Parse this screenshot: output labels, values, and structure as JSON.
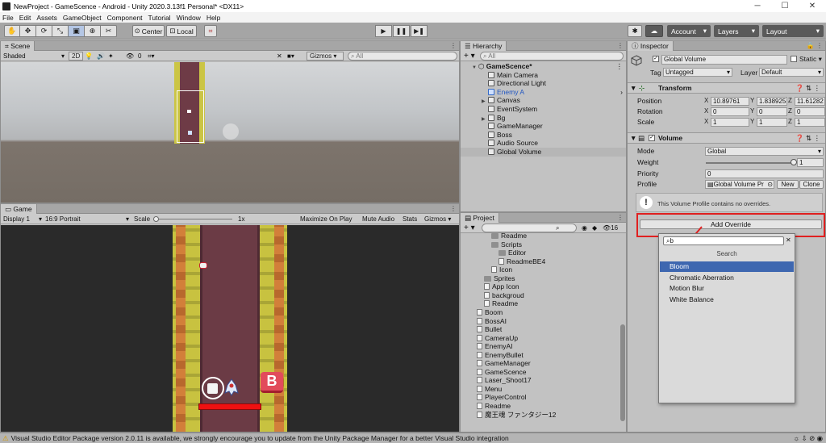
{
  "window": {
    "title": "NewProject - GameScence - Android - Unity 2020.3.13f1 Personal* <DX11>",
    "minimize": "─",
    "maximize": "☐",
    "close": "✕"
  },
  "menu": [
    "File",
    "Edit",
    "Assets",
    "GameObject",
    "Component",
    "Tutorial",
    "Window",
    "Help"
  ],
  "toolbar": {
    "tools": [
      "✋",
      "✥",
      "⟳",
      "⤡",
      "▣",
      "⊕",
      "✂"
    ],
    "pivot": "Center",
    "space": "Local",
    "grid": "⌗",
    "play": "▶",
    "pause": "❚❚",
    "step": "▶❚",
    "collab": "✱",
    "cloud": "☁",
    "account": "Account",
    "layers": "Layers",
    "layout": "Layout"
  },
  "scene": {
    "tab": "Scene",
    "shading": "Shaded",
    "mode2d": "2D",
    "hidden_count": "0",
    "gizmos": "Gizmos",
    "search_placeholder": "All"
  },
  "game": {
    "tab": "Game",
    "display": "Display 1",
    "aspect": "16:9 Portrait",
    "scale_label": "Scale",
    "scale_value": "1x",
    "maximize": "Maximize On Play",
    "mute": "Mute Audio",
    "stats": "Stats",
    "gizmos": "Gizmos",
    "boss_letter": "B"
  },
  "hierarchy": {
    "tab": "Hierarchy",
    "add": "+",
    "search_placeholder": "All",
    "scene_name": "GameScence*",
    "items": [
      {
        "label": "Main Camera",
        "icon": "cube",
        "expandable": false,
        "selected": false,
        "blue": false
      },
      {
        "label": "Directional Light",
        "icon": "cube",
        "expandable": false,
        "selected": false,
        "blue": false
      },
      {
        "label": "Enemy A",
        "icon": "cube",
        "expandable": false,
        "selected": false,
        "blue": true
      },
      {
        "label": "Canvas",
        "icon": "cube",
        "expandable": true,
        "selected": false,
        "blue": false
      },
      {
        "label": "EventSystem",
        "icon": "cube",
        "expandable": false,
        "selected": false,
        "blue": false
      },
      {
        "label": "Bg",
        "icon": "cube",
        "expandable": true,
        "selected": false,
        "blue": false
      },
      {
        "label": "GameManager",
        "icon": "cube",
        "expandable": false,
        "selected": false,
        "blue": false
      },
      {
        "label": "Boss",
        "icon": "cube",
        "expandable": false,
        "selected": false,
        "blue": false
      },
      {
        "label": "Audio Source",
        "icon": "cube",
        "expandable": false,
        "selected": false,
        "blue": false
      },
      {
        "label": "Global Volume",
        "icon": "cube",
        "expandable": false,
        "selected": true,
        "blue": false
      }
    ]
  },
  "project": {
    "tab": "Project",
    "add": "+",
    "count": "16",
    "items": [
      {
        "label": "Readme",
        "icon": "folder",
        "indent": 2
      },
      {
        "label": "Scripts",
        "icon": "folder",
        "indent": 2
      },
      {
        "label": "Editor",
        "icon": "folder",
        "indent": 3
      },
      {
        "label": "ReadmeBE4",
        "icon": "file",
        "indent": 3
      },
      {
        "label": "Icon",
        "icon": "file",
        "indent": 2
      },
      {
        "label": "Sprites",
        "icon": "folder",
        "indent": 1
      },
      {
        "label": "App Icon",
        "icon": "file",
        "indent": 1
      },
      {
        "label": "backgroud",
        "icon": "file",
        "indent": 1
      },
      {
        "label": "Readme",
        "icon": "file",
        "indent": 1
      },
      {
        "label": "Boom",
        "icon": "file",
        "indent": 0
      },
      {
        "label": "BossAI",
        "icon": "file",
        "indent": 0
      },
      {
        "label": "Bullet",
        "icon": "file",
        "indent": 0
      },
      {
        "label": "CameraUp",
        "icon": "file",
        "indent": 0
      },
      {
        "label": "EnemyAI",
        "icon": "file",
        "indent": 0
      },
      {
        "label": "EnemyBullet",
        "icon": "file",
        "indent": 0
      },
      {
        "label": "GameManager",
        "icon": "file",
        "indent": 0
      },
      {
        "label": "GameScence",
        "icon": "file",
        "indent": 0
      },
      {
        "label": "Laser_Shoot17",
        "icon": "file",
        "indent": 0
      },
      {
        "label": "Menu",
        "icon": "file",
        "indent": 0
      },
      {
        "label": "PlayerControl",
        "icon": "file",
        "indent": 0
      },
      {
        "label": "Readme",
        "icon": "file",
        "indent": 0
      },
      {
        "label": "魔王魂 ファンタジー12",
        "icon": "file",
        "indent": 0
      }
    ]
  },
  "inspector": {
    "tab": "Inspector",
    "object_name": "Global Volume",
    "static_label": "Static",
    "tag_label": "Tag",
    "tag_value": "Untagged",
    "layer_label": "Layer",
    "layer_value": "Default",
    "transform": {
      "title": "Transform",
      "position_label": "Position",
      "rotation_label": "Rotation",
      "scale_label": "Scale",
      "position": {
        "x": "10.89761",
        "y": "1.838925",
        "z": "11.61282"
      },
      "rotation": {
        "x": "0",
        "y": "0",
        "z": "0"
      },
      "scale": {
        "x": "1",
        "y": "1",
        "z": "1"
      }
    },
    "volume": {
      "title": "Volume",
      "mode_label": "Mode",
      "mode_value": "Global",
      "weight_label": "Weight",
      "weight_value": "1",
      "weight_fraction": 1.0,
      "priority_label": "Priority",
      "priority_value": "0",
      "profile_label": "Profile",
      "profile_value": "Global Volume Pr",
      "new_button": "New",
      "clone_button": "Clone",
      "info": "This Volume Profile contains no overrides.",
      "add_override": "Add Override"
    }
  },
  "popup": {
    "search_value": "b",
    "header": "Search",
    "items": [
      "Bloom",
      "Chromatic Aberration",
      "Motion Blur",
      "White Balance"
    ],
    "selected": 0
  },
  "status": {
    "message": "Visual Studio Editor Package version 2.0.11 is available, we strongly encourage you to update from the Unity Package Manager for a better Visual Studio integration"
  },
  "colors": {
    "highlight": "#e02020",
    "selection": "#3e67b0",
    "road": "#6e3b46",
    "grass": "#cbc545"
  }
}
